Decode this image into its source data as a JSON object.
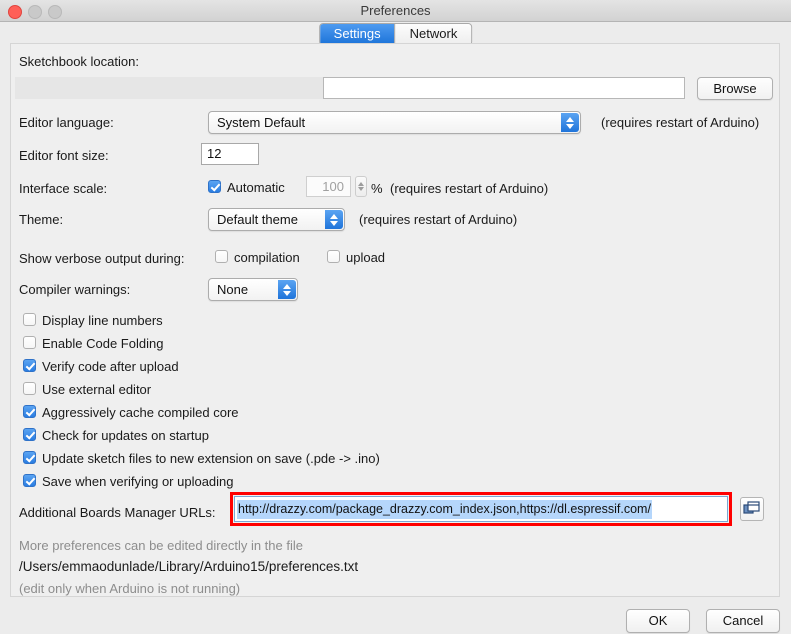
{
  "window": {
    "title": "Preferences",
    "traffic_lights": [
      "close",
      "minimize",
      "maximize"
    ]
  },
  "tabs": [
    {
      "label": "Settings",
      "active": true
    },
    {
      "label": "Network",
      "active": false
    }
  ],
  "settings": {
    "sketchbook": {
      "label": "Sketchbook location:",
      "value": "",
      "browse_label": "Browse"
    },
    "editor_language": {
      "label": "Editor language:",
      "value": "System Default",
      "note": "(requires restart of Arduino)"
    },
    "editor_font_size": {
      "label": "Editor font size:",
      "value": "12"
    },
    "interface_scale": {
      "label": "Interface scale:",
      "automatic_label": "Automatic",
      "automatic_checked": true,
      "value": "100",
      "unit": "%",
      "note": "(requires restart of Arduino)"
    },
    "theme": {
      "label": "Theme:",
      "value": "Default theme",
      "note": "(requires restart of Arduino)"
    },
    "verbose": {
      "label": "Show verbose output during:",
      "compilation_label": "compilation",
      "compilation_checked": false,
      "upload_label": "upload",
      "upload_checked": false
    },
    "compiler_warnings": {
      "label": "Compiler warnings:",
      "value": "None"
    },
    "checkboxes": [
      {
        "label": "Display line numbers",
        "checked": false
      },
      {
        "label": "Enable Code Folding",
        "checked": false
      },
      {
        "label": "Verify code after upload",
        "checked": true
      },
      {
        "label": "Use external editor",
        "checked": false
      },
      {
        "label": "Aggressively cache compiled core",
        "checked": true
      },
      {
        "label": "Check for updates on startup",
        "checked": true
      },
      {
        "label": "Update sketch files to new extension on save (.pde -> .ino)",
        "checked": true
      },
      {
        "label": "Save when verifying or uploading",
        "checked": true
      }
    ],
    "boards_urls": {
      "label": "Additional Boards Manager URLs:",
      "value": "http://drazzy.com/package_drazzy.com_index.json,https://dl.espressif.com/",
      "selected": true,
      "button_icon": "windows-copy-icon"
    },
    "footer_notes": {
      "line1": "More preferences can be edited directly in the file",
      "path": "/Users/emmaodunlade/Library/Arduino15/preferences.txt",
      "line3": "(edit only when Arduino is not running)"
    }
  },
  "footer": {
    "ok_label": "OK",
    "cancel_label": "Cancel"
  },
  "colors": {
    "accent_blue": "#2a7de2",
    "highlight_red": "#ff0000",
    "selection_blue": "#b5d6fb",
    "window_bg": "#ececec",
    "panel_bg": "#efefef"
  }
}
